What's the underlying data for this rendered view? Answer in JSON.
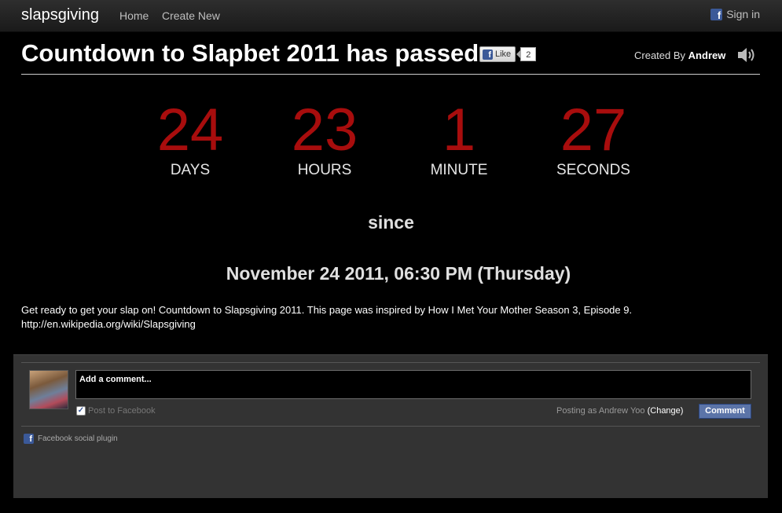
{
  "nav": {
    "brand": "slapsgiving",
    "home": "Home",
    "create_new": "Create New",
    "sign_in": "Sign in"
  },
  "header": {
    "title": "Countdown to Slapbet 2011 has passed",
    "like_label": "Like",
    "like_count": "2",
    "created_by_prefix": "Created By",
    "created_by_name": "Andrew"
  },
  "countdown": [
    {
      "value": "24",
      "unit": "DAYS"
    },
    {
      "value": "23",
      "unit": "HOURS"
    },
    {
      "value": "1",
      "unit": "MINUTE"
    },
    {
      "value": "27",
      "unit": "SECONDS"
    }
  ],
  "since": "since",
  "target_date": "November 24 2011, 06:30 PM (Thursday)",
  "description": {
    "line1": "Get ready to get your slap on! Countdown to Slapsgiving 2011. This page was inspired by How I Met Your Mother Season 3, Episode 9.",
    "line2": "http://en.wikipedia.org/wiki/Slapsgiving"
  },
  "comments": {
    "placeholder": "Add a comment...",
    "post_to_facebook": "Post to Facebook",
    "post_to_facebook_checked": true,
    "posting_as": "Posting as Andrew Yoo",
    "change": "(Change)",
    "comment_button": "Comment",
    "plugin_label": "Facebook social plugin"
  },
  "colors": {
    "countdown_red": "#a80d0d",
    "facebook_blue": "#3b5998",
    "comment_button": "#5b74a8"
  },
  "icons": {
    "speaker": "speaker-icon",
    "facebook": "facebook-icon"
  }
}
